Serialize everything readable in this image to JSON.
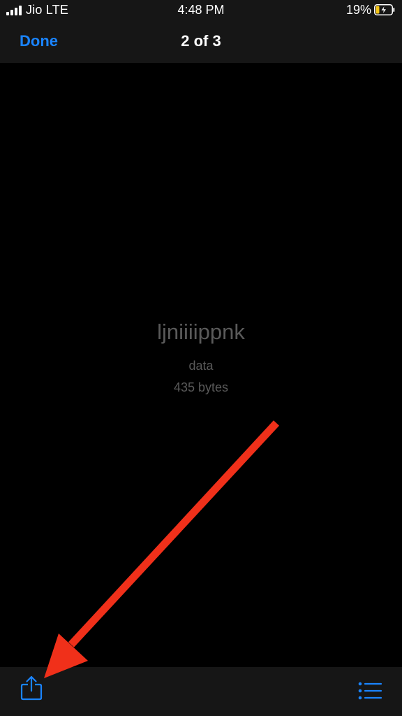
{
  "status_bar": {
    "carrier": "Jio  LTE",
    "time": "4:48 PM",
    "battery": "19%"
  },
  "nav": {
    "done_label": "Done",
    "title": "2 of 3"
  },
  "file": {
    "name": "ljniiiippnk",
    "type": "data",
    "size": "435 bytes"
  },
  "toolbar": {
    "share_icon": "share-icon",
    "list_icon": "list-icon"
  },
  "colors": {
    "accent": "#1a84ff",
    "annotation_arrow": "#f0301a",
    "battery_low": "#f5c518"
  }
}
